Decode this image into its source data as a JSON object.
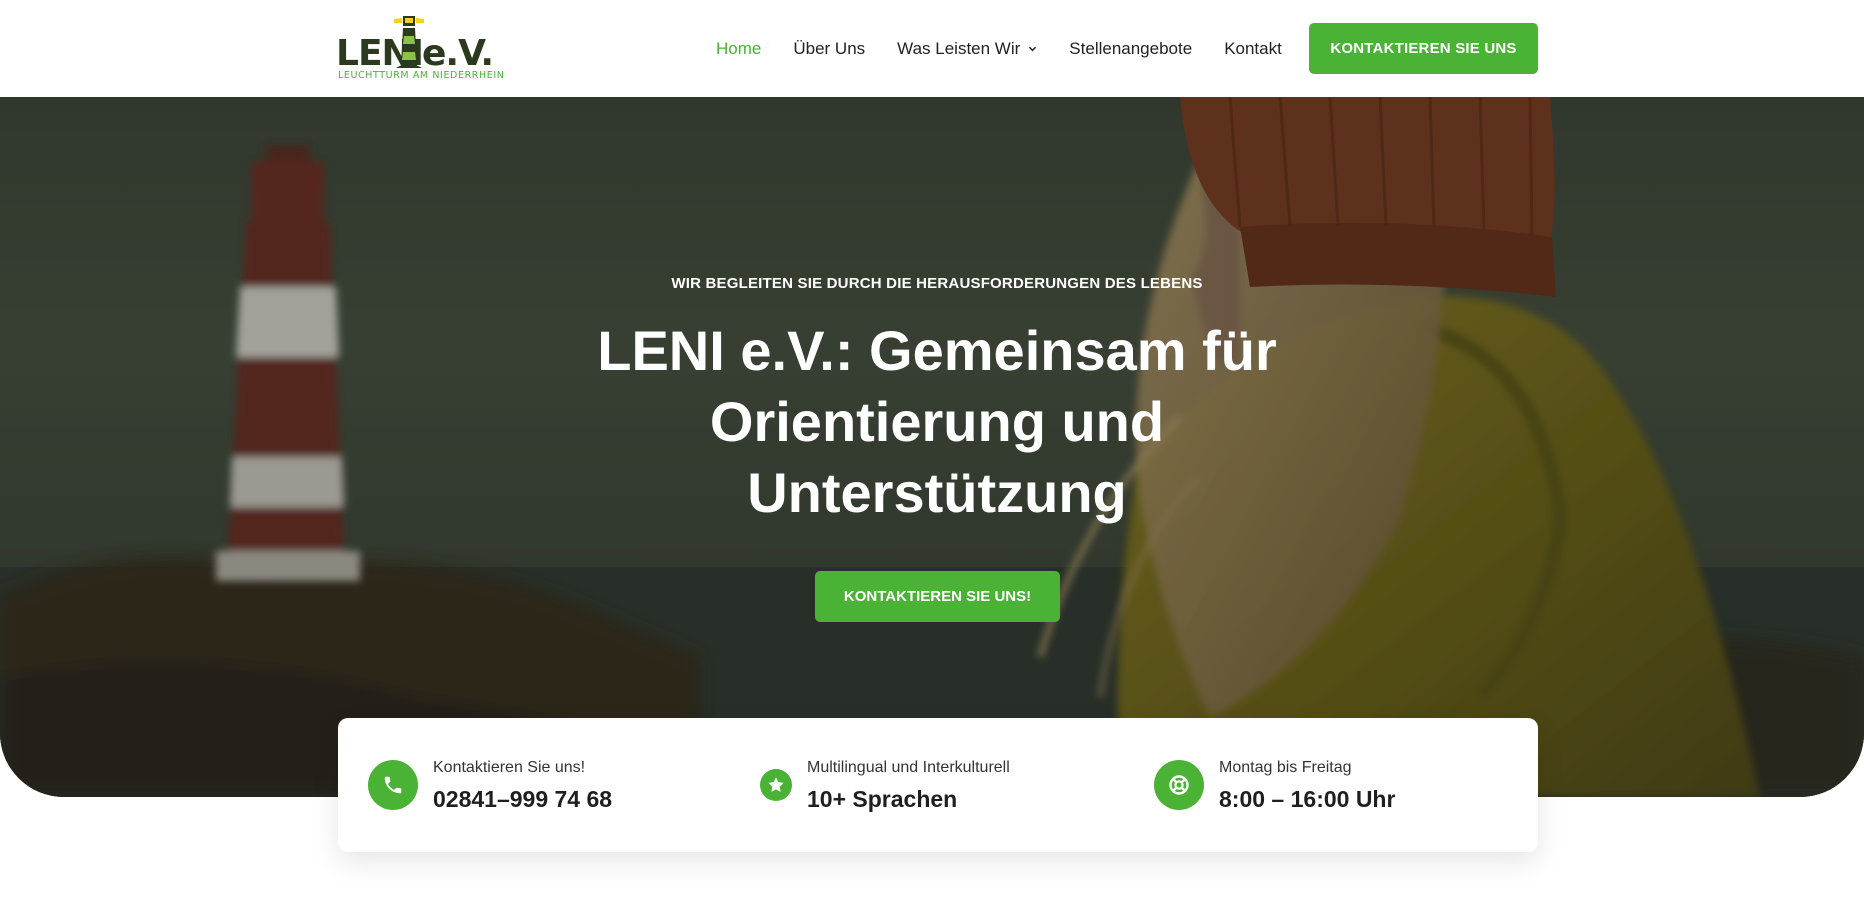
{
  "brand": {
    "name": "LENI",
    "suffix": "e.V.",
    "tagline": "LEUCHTTURM AM NIEDERRHEIN"
  },
  "nav": {
    "items": [
      {
        "label": "Home",
        "active": true
      },
      {
        "label": "Über Uns",
        "active": false
      },
      {
        "label": "Was Leisten Wir",
        "active": false,
        "has_dropdown": true
      },
      {
        "label": "Stellenangebote",
        "active": false
      },
      {
        "label": "Kontakt",
        "active": false
      }
    ],
    "cta_label": "KONTAKTIEREN SIE UNS"
  },
  "hero": {
    "eyebrow": "WIR BEGLEITEN SIE DURCH DIE HERAUSFORDERUNGEN DES LEBENS",
    "title": "LENI e.V.: Gemeinsam für Orientierung und Unterstützung",
    "cta_label": "KONTAKTIEREN SIE UNS!"
  },
  "info": [
    {
      "icon": "phone-icon",
      "label": "Kontaktieren Sie uns!",
      "value": "02841–999 74 68"
    },
    {
      "icon": "star-icon",
      "label": "Multilingual und Interkulturell",
      "value": "10+ Sprachen"
    },
    {
      "icon": "lifebuoy-icon",
      "label": "Montag bis Freitag",
      "value": "8:00 – 16:00 Uhr"
    }
  ],
  "colors": {
    "accent": "#4ab234",
    "nav_text": "#222222",
    "hero_overlay": "#2f3a2a"
  }
}
